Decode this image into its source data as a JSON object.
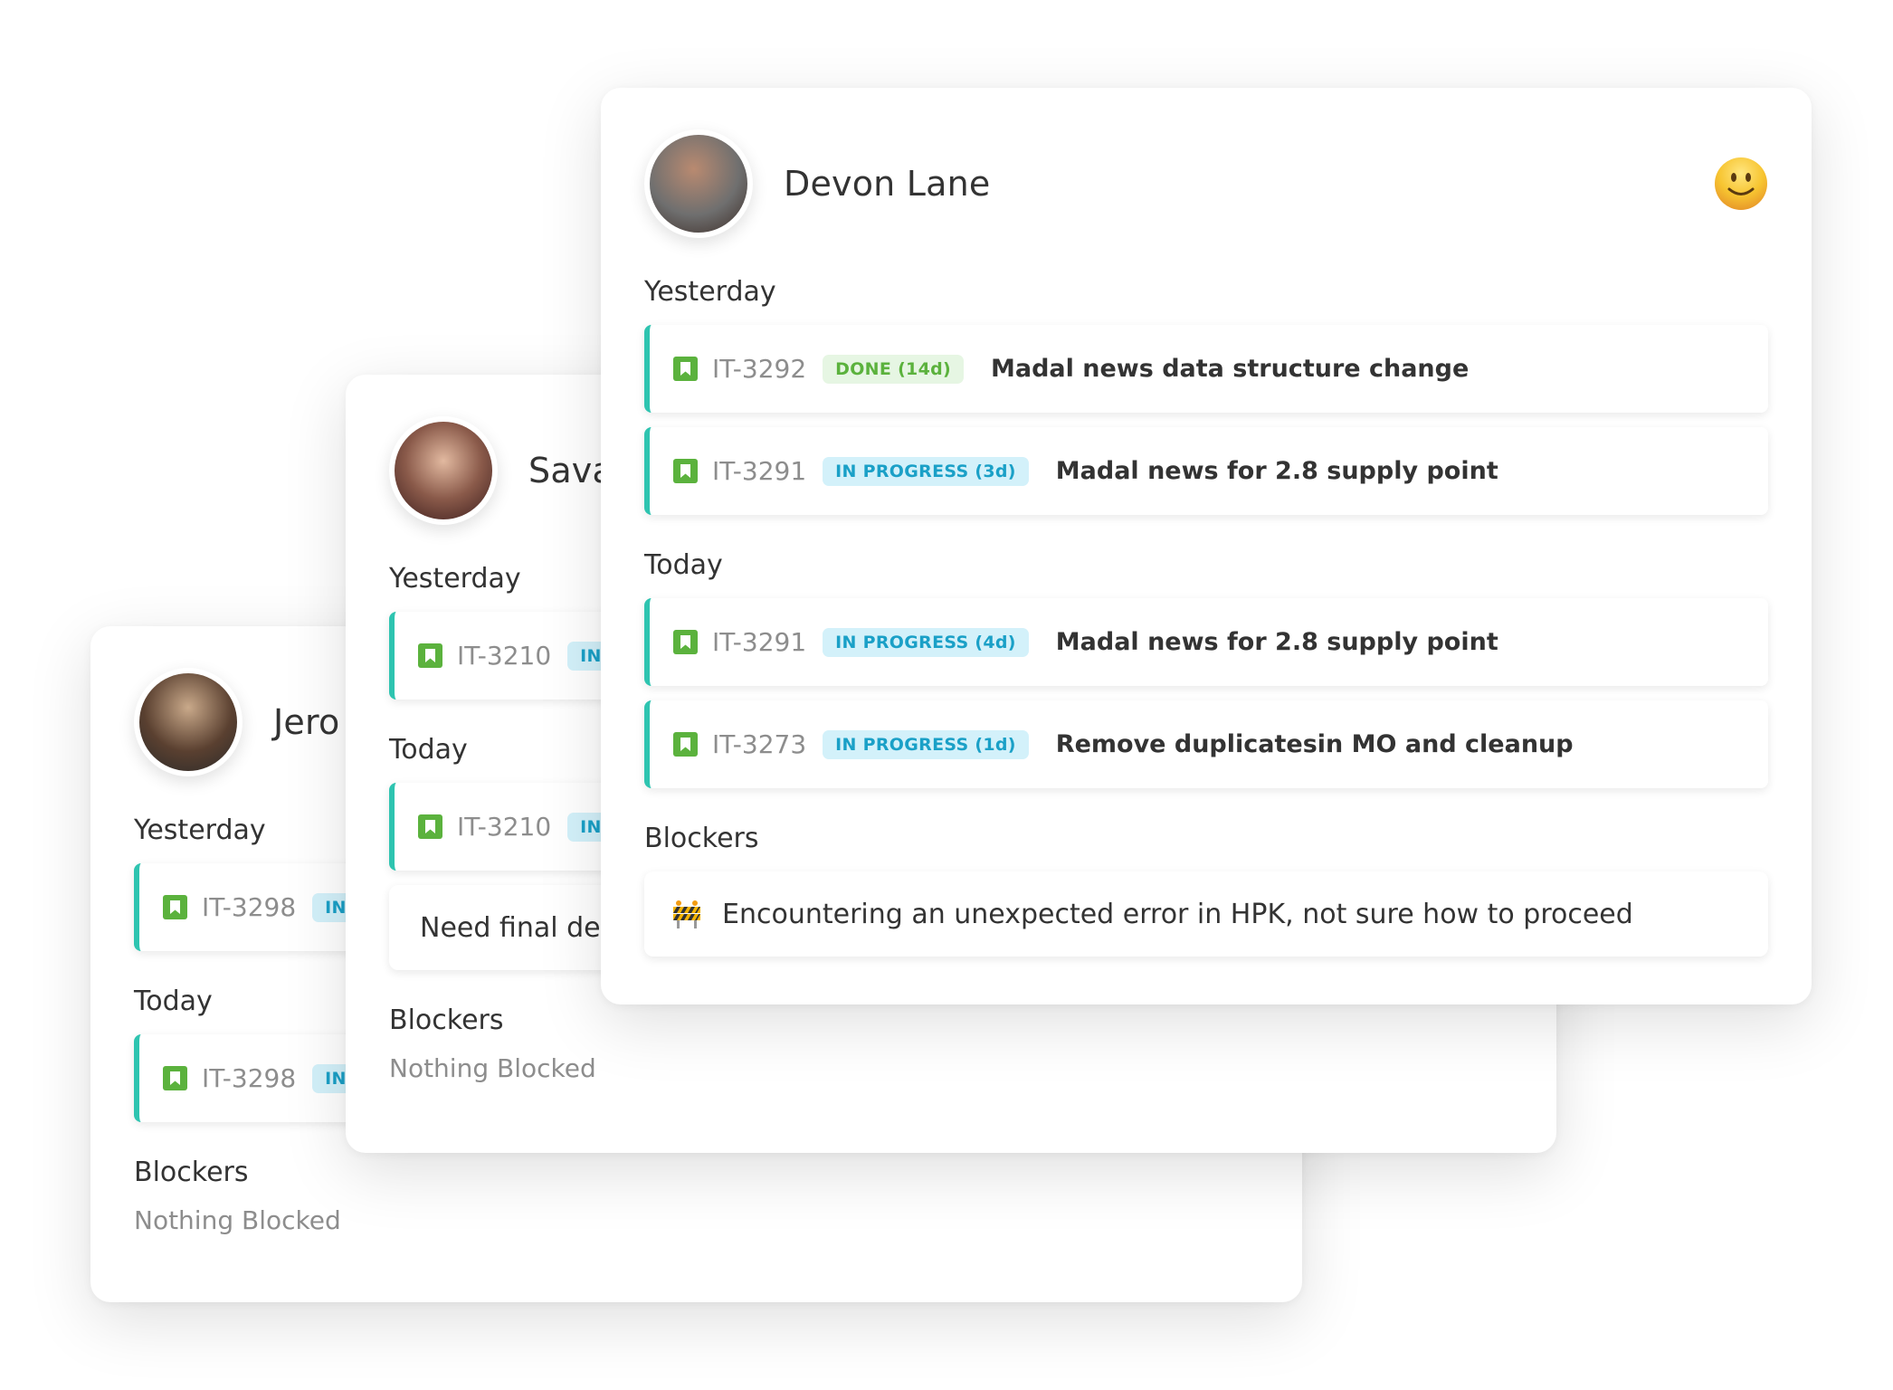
{
  "colors": {
    "accent_border": "#2ec4b0",
    "done_bg": "#e6f6e3",
    "done_text": "#5bb23d",
    "progress_bg": "#d3f1fa",
    "progress_text": "#1aa0c7",
    "bookmark": "#5bb23d"
  },
  "cards": [
    {
      "name": "Jero",
      "avatar": "avatar-photo-bearded-man-beanie",
      "sections": [
        {
          "label": "Yesterday",
          "items": [
            {
              "type": "task",
              "id": "IT-3298",
              "status": "IN",
              "status_kind": "prog",
              "title": ""
            }
          ]
        },
        {
          "label": "Today",
          "items": [
            {
              "type": "task",
              "id": "IT-3298",
              "status": "IN",
              "status_kind": "prog",
              "title": ""
            }
          ]
        },
        {
          "label": "Blockers",
          "empty": "Nothing Blocked"
        }
      ]
    },
    {
      "name": "Sava",
      "avatar": "avatar-photo-man-glasses",
      "sections": [
        {
          "label": "Yesterday",
          "items": [
            {
              "type": "task",
              "id": "IT-3210",
              "status": "IN",
              "status_kind": "prog",
              "title": ""
            }
          ]
        },
        {
          "label": "Today",
          "items": [
            {
              "type": "task",
              "id": "IT-3210",
              "status": "IN",
              "status_kind": "prog",
              "title": ""
            },
            {
              "type": "note",
              "text": "Need final des"
            }
          ]
        },
        {
          "label": "Blockers",
          "empty": "Nothing Blocked"
        }
      ]
    },
    {
      "name": "Devon Lane",
      "avatar": "avatar-photo-man-cap",
      "mood": "smiley-face-icon",
      "sections": [
        {
          "label": "Yesterday",
          "items": [
            {
              "type": "task",
              "id": "IT-3292",
              "status": "DONE (14d)",
              "status_kind": "done",
              "title": "Madal news data structure change"
            },
            {
              "type": "task",
              "id": "IT-3291",
              "status": "IN PROGRESS (3d)",
              "status_kind": "prog",
              "title": "Madal news for 2.8 supply point"
            }
          ]
        },
        {
          "label": "Today",
          "items": [
            {
              "type": "task",
              "id": "IT-3291",
              "status": "IN PROGRESS (4d)",
              "status_kind": "prog",
              "title": "Madal news for 2.8 supply point"
            },
            {
              "type": "task",
              "id": "IT-3273",
              "status": "IN PROGRESS (1d)",
              "status_kind": "prog",
              "title": "Remove duplicatesin MO and cleanup"
            }
          ]
        },
        {
          "label": "Blockers",
          "items": [
            {
              "type": "blocker",
              "icon": "construction-barrier-icon",
              "text": "Encountering an unexpected error in HPK, not sure how to proceed"
            }
          ]
        }
      ]
    }
  ]
}
